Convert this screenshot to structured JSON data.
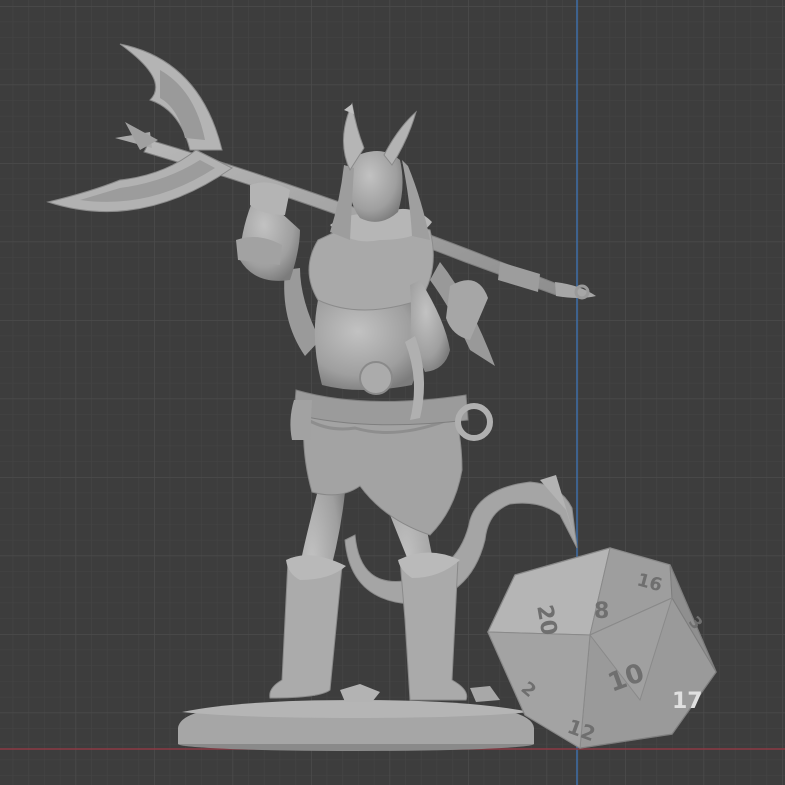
{
  "viewport": {
    "background": "#3d3d3d",
    "grid_minor_color": "#444444",
    "grid_major_color": "#4c4c4c",
    "axis_x_color": "#8c3a44",
    "axis_z_color": "#3f6fa8",
    "model_color": "#a9a9a9"
  },
  "scene": {
    "figure": "horned tiefling barbarian miniature holding a double-bladed axe",
    "die": "d20 icosahedron die"
  },
  "die_faces": {
    "f20": "20",
    "f8": "8",
    "f16": "16",
    "f10": "10",
    "f17": "17",
    "f2": "2",
    "f12": "12",
    "f3": "3"
  }
}
